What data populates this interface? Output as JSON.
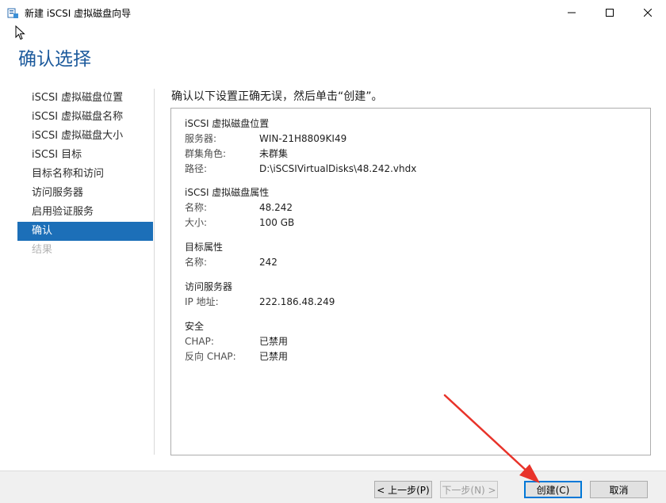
{
  "window": {
    "title": "新建 iSCSI 虚拟磁盘向导",
    "icon": "wizard-app-icon"
  },
  "page": {
    "title": "确认选择",
    "heading": "确认以下设置正确无误，然后单击“创建”。"
  },
  "nav": {
    "items": [
      {
        "label": "iSCSI 虚拟磁盘位置",
        "state": "normal"
      },
      {
        "label": "iSCSI 虚拟磁盘名称",
        "state": "normal"
      },
      {
        "label": "iSCSI 虚拟磁盘大小",
        "state": "normal"
      },
      {
        "label": "iSCSI 目标",
        "state": "normal"
      },
      {
        "label": "目标名称和访问",
        "state": "normal"
      },
      {
        "label": "访问服务器",
        "state": "normal"
      },
      {
        "label": "启用验证服务",
        "state": "normal"
      },
      {
        "label": "确认",
        "state": "active"
      },
      {
        "label": "结果",
        "state": "disabled"
      }
    ]
  },
  "summary": {
    "location": {
      "title": "iSCSI 虚拟磁盘位置",
      "server_label": "服务器:",
      "server_value": "WIN-21H8809KI49",
      "cluster_label": "群集角色:",
      "cluster_value": "未群集",
      "path_label": "路径:",
      "path_value": "D:\\iSCSIVirtualDisks\\48.242.vhdx"
    },
    "properties": {
      "title": "iSCSI 虚拟磁盘属性",
      "name_label": "名称:",
      "name_value": "48.242",
      "size_label": "大小:",
      "size_value": "100 GB"
    },
    "target": {
      "title": "目标属性",
      "name_label": "名称:",
      "name_value": "242"
    },
    "access": {
      "title": "访问服务器",
      "ip_label": "IP 地址:",
      "ip_value": "222.186.48.249"
    },
    "security": {
      "title": "安全",
      "chap_label": "CHAP:",
      "chap_value": "已禁用",
      "rchap_label": "反向 CHAP:",
      "rchap_value": "已禁用"
    }
  },
  "buttons": {
    "prev": "< 上一步(P)",
    "next": "下一步(N) >",
    "create": "创建(C)",
    "cancel": "取消"
  },
  "colors": {
    "title_blue": "#1c5a9c",
    "active_nav": "#1c6fb8",
    "annotation_arrow": "#e8332a"
  }
}
